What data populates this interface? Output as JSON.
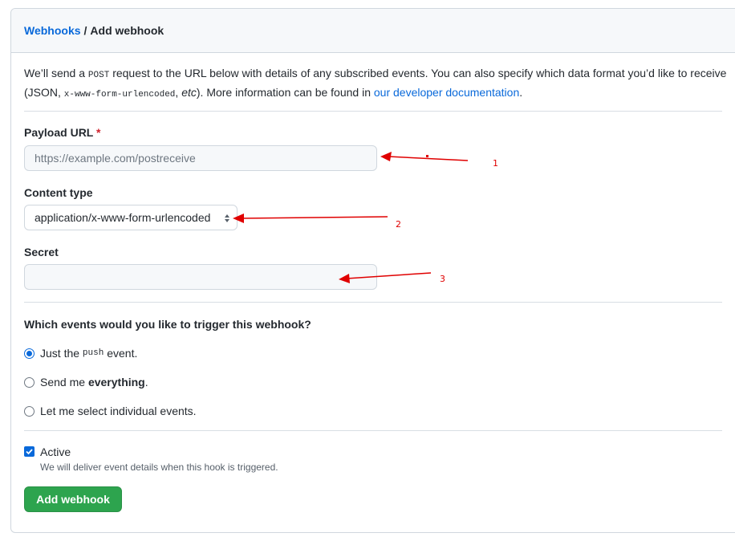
{
  "breadcrumb": {
    "parent": "Webhooks",
    "separator": "/",
    "current": "Add webhook"
  },
  "intro": {
    "part1": "We’ll send a ",
    "code1": "POST",
    "part2": " request to the URL below with details of any subscribed events. You can also specify which data format you’d like to receive (JSON, ",
    "code2": "x-www-form-urlencoded",
    "part3": ", ",
    "etc": "etc",
    "part4": "). More information can be found in ",
    "link": "our developer documentation",
    "part5": "."
  },
  "payload_url": {
    "label": "Payload URL",
    "required_mark": "*",
    "placeholder": "https://example.com/postreceive"
  },
  "content_type": {
    "label": "Content type",
    "selected": "application/x-www-form-urlencoded"
  },
  "secret": {
    "label": "Secret",
    "value": ""
  },
  "events": {
    "question": "Which events would you like to trigger this webhook?",
    "opt1_pre": "Just the ",
    "opt1_code": "push",
    "opt1_post": " event.",
    "opt2_pre": "Send me ",
    "opt2_bold": "everything",
    "opt2_post": ".",
    "opt3": "Let me select individual events."
  },
  "active": {
    "label": "Active",
    "checked": true,
    "description": "We will deliver event details when this hook is triggered."
  },
  "submit_label": "Add webhook",
  "annotations": {
    "one": "1",
    "two": "2",
    "three": "3"
  },
  "colors": {
    "link": "#0969da",
    "button": "#2da44e",
    "annotation": "#e00000"
  }
}
